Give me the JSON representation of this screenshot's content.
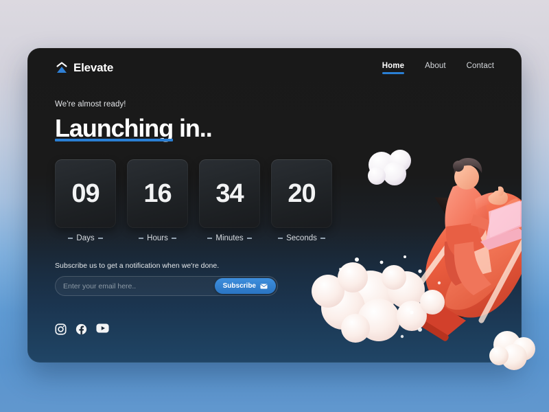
{
  "brand": {
    "name": "Elevate",
    "logo_icon": "mountain-chevron-icon",
    "accent_color": "#2a7fd4"
  },
  "nav": {
    "items": [
      {
        "label": "Home",
        "active": true
      },
      {
        "label": "About",
        "active": false
      },
      {
        "label": "Contact",
        "active": false
      }
    ]
  },
  "hero": {
    "eyebrow": "We're almost ready!",
    "headline_accent": "Launching",
    "headline_rest": " in.."
  },
  "countdown": {
    "units": [
      {
        "value": "09",
        "label": "Days"
      },
      {
        "value": "16",
        "label": "Hours"
      },
      {
        "value": "34",
        "label": "Minutes"
      },
      {
        "value": "20",
        "label": "Seconds"
      }
    ]
  },
  "subscribe": {
    "note": "Subscribe us to get a notification when we're done.",
    "placeholder": "Enter your email here..",
    "value": "",
    "button_label": "Subscribe",
    "button_icon": "envelope-icon",
    "button_color": "#2a74c2"
  },
  "social": {
    "items": [
      {
        "name": "instagram-icon"
      },
      {
        "name": "facebook-icon"
      },
      {
        "name": "youtube-icon"
      }
    ]
  },
  "illustration": {
    "subject": "3d-astronaut-on-rocket-with-laptop",
    "rocket_color": "#e8563a",
    "suit_color": "#f08a72",
    "cloud_color": "#f3f0f4"
  },
  "page_background": {
    "top_color": "#dcd9e0",
    "bottom_color": "#6197ce"
  }
}
